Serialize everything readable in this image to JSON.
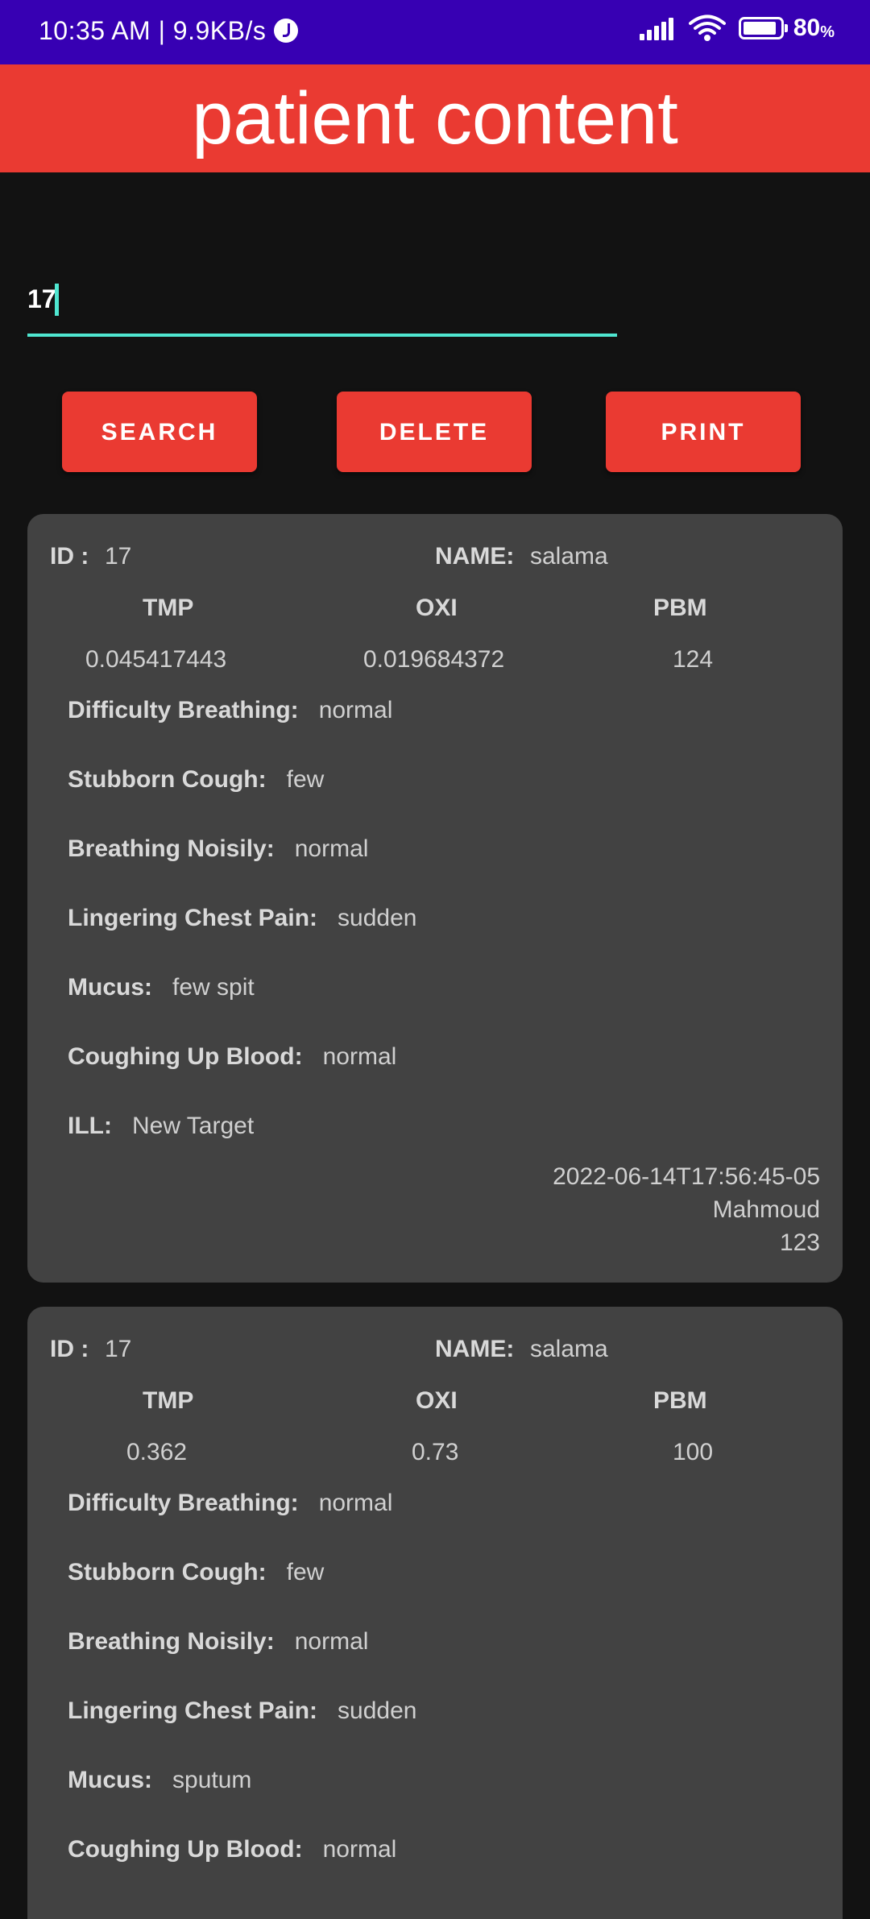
{
  "status_bar": {
    "time": "10:35 AM | 9.9KB/s",
    "battery": "80",
    "battery_unit": "%"
  },
  "app_bar": {
    "title": "patient content"
  },
  "search": {
    "value": "17"
  },
  "buttons": {
    "search": "SEARCH",
    "delete": "DELETE",
    "print": "PRINT"
  },
  "labels": {
    "id": "ID :",
    "name": "NAME:",
    "tmp": "TMP",
    "oxi": "OXI",
    "pbm": "PBM",
    "difficulty_breathing": "Difficulty Breathing:",
    "stubborn_cough": "Stubborn Cough:",
    "breathing_noisily": "Breathing Noisily:",
    "lingering_chest_pain": "Lingering Chest Pain:",
    "mucus": "Mucus:",
    "coughing_up_blood": "Coughing Up Blood:",
    "ill": "ILL:"
  },
  "records": [
    {
      "id": "17",
      "name": "salama",
      "tmp": "0.045417443",
      "oxi": "0.019684372",
      "pbm": "124",
      "difficulty_breathing": "normal",
      "stubborn_cough": "few",
      "breathing_noisily": "normal",
      "lingering_chest_pain": "sudden",
      "mucus": "few spit",
      "coughing_up_blood": "normal",
      "ill": "New Target",
      "timestamp": "2022-06-14T17:56:45-05",
      "doctor": "Mahmoud",
      "code": "123"
    },
    {
      "id": "17",
      "name": "salama",
      "tmp": "0.362",
      "oxi": "0.73",
      "pbm": "100",
      "difficulty_breathing": "normal",
      "stubborn_cough": "few",
      "breathing_noisily": "normal",
      "lingering_chest_pain": "sudden",
      "mucus": "sputum",
      "coughing_up_blood": "normal"
    }
  ]
}
